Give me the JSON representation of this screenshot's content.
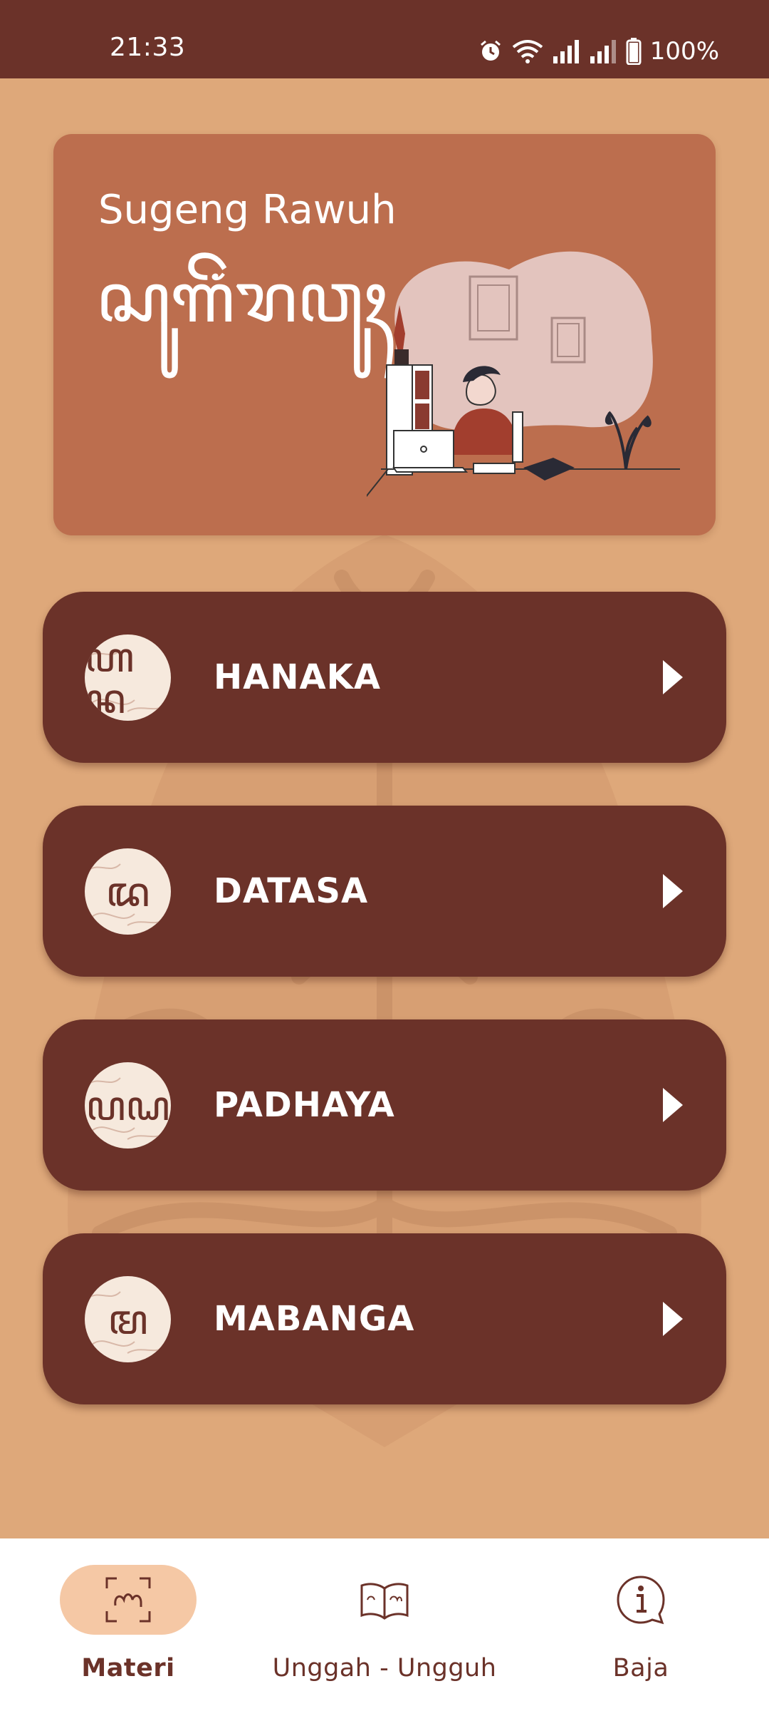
{
  "status_bar": {
    "time": "21:33",
    "battery": "100%",
    "icons": [
      "alarm-icon",
      "wifi-icon",
      "signal-icon",
      "signal-icon",
      "battery-icon"
    ]
  },
  "greeting": {
    "title": "Sugeng Rawuh",
    "script_text": "ꦱꦸꦒꦼꦁꦫꦮꦸꦃ"
  },
  "lessons": [
    {
      "label": "HANAKA",
      "glyph": "ꦲꦤ"
    },
    {
      "label": "DATASA",
      "glyph": "ꦢ"
    },
    {
      "label": "PADHAYA",
      "glyph": "ꦥꦝ"
    },
    {
      "label": "MABANGA",
      "glyph": "ꦩ"
    }
  ],
  "bottom_nav": {
    "items": [
      {
        "label": "Materi",
        "icon": "scan-script-icon",
        "active": true
      },
      {
        "label": "Unggah - Ungguh",
        "icon": "open-book-icon",
        "active": false
      },
      {
        "label": "Baja",
        "icon": "info-icon",
        "active": false
      }
    ]
  },
  "colors": {
    "background": "#DEA87A",
    "primary": "#6B3229",
    "card": "#BC6E4E",
    "nav_active_pill": "#F5C8A5"
  }
}
